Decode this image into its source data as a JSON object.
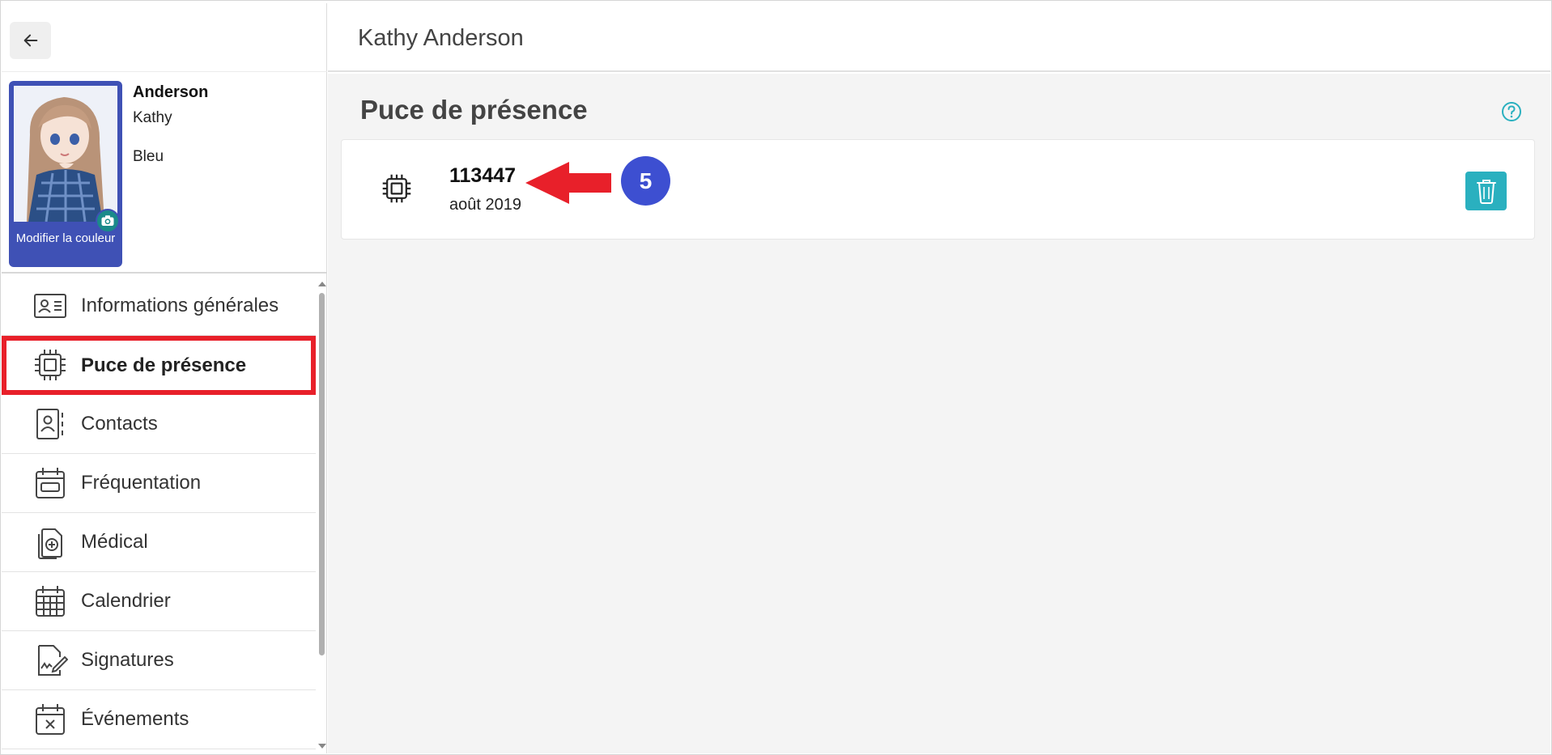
{
  "header": {
    "title": "Kathy Anderson"
  },
  "profile": {
    "last_name": "Anderson",
    "first_name": "Kathy",
    "group": "Bleu",
    "photo_label": "Modifier la couleur",
    "card_color": "#3f51b5"
  },
  "nav": {
    "items": [
      {
        "label": "Informations générales",
        "icon": "id-card-icon"
      },
      {
        "label": "Puce de présence",
        "icon": "chip-icon",
        "active": true
      },
      {
        "label": "Contacts",
        "icon": "contact-book-icon"
      },
      {
        "label": "Fréquentation",
        "icon": "attendance-calendar-icon"
      },
      {
        "label": "Médical",
        "icon": "medical-file-icon"
      },
      {
        "label": "Calendrier",
        "icon": "calendar-grid-icon"
      },
      {
        "label": "Signatures",
        "icon": "signature-icon"
      },
      {
        "label": "Événements",
        "icon": "event-cancel-icon"
      }
    ],
    "active_highlight_color": "#e8202a"
  },
  "main": {
    "section_title": "Puce de présence",
    "chip": {
      "id": "113447",
      "date": "août 2019"
    },
    "annotation_step": "5",
    "accent_color": "#2ab0bf",
    "annotation_color": "#3d4fd1"
  }
}
